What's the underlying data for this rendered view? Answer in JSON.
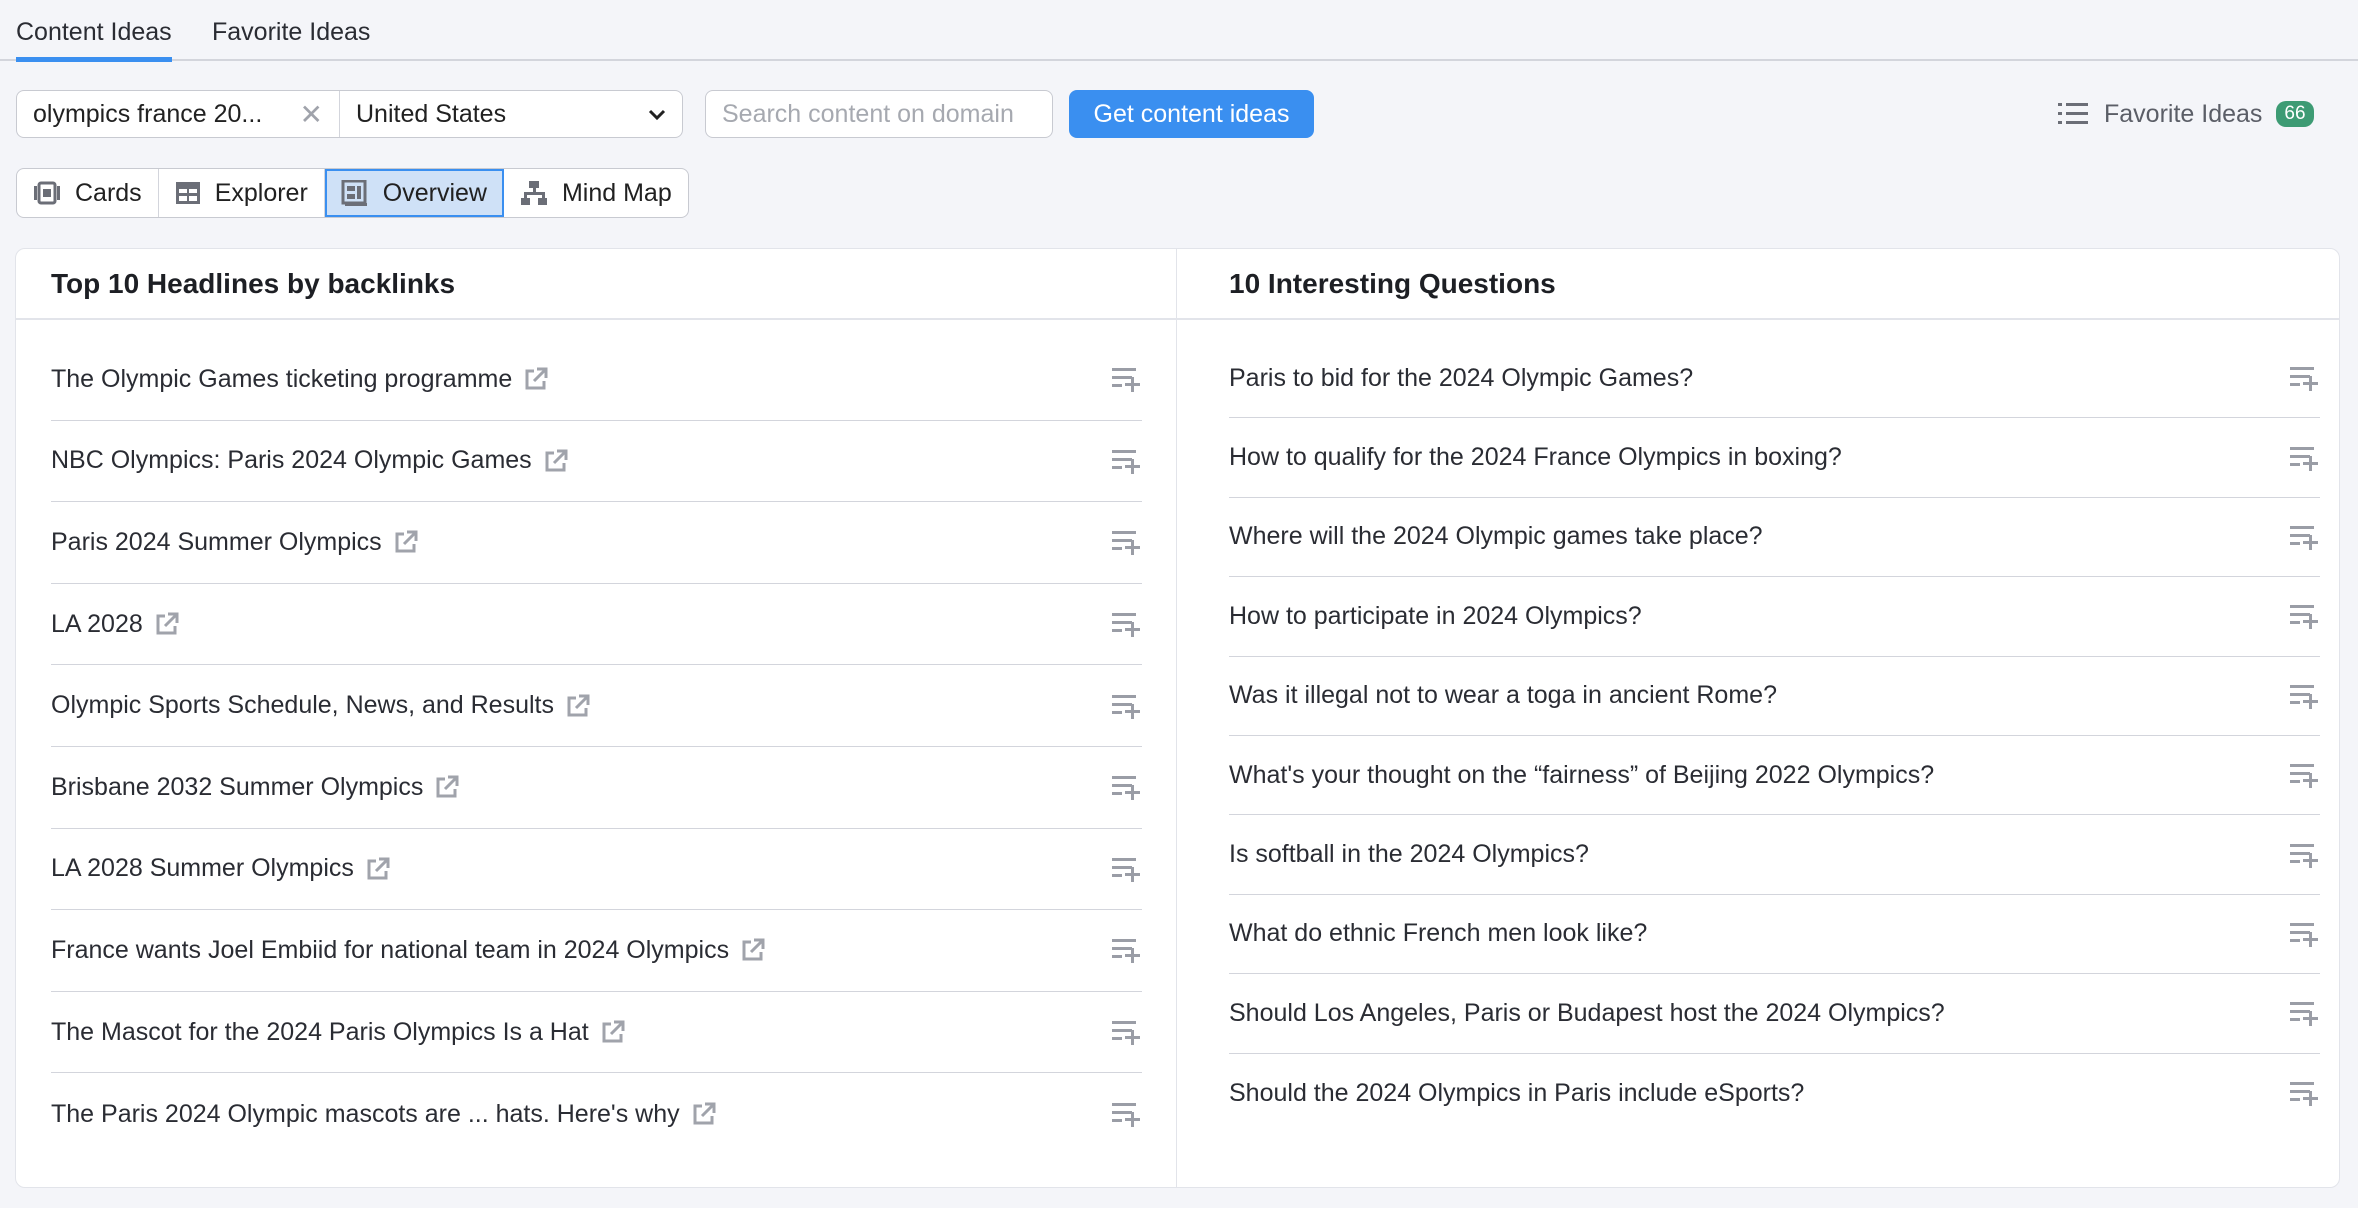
{
  "tabs": [
    {
      "label": "Content Ideas",
      "active": true
    },
    {
      "label": "Favorite Ideas",
      "active": false
    }
  ],
  "toolbar": {
    "keyword_value": "olympics france 20...",
    "country": "United States",
    "search_placeholder": "Search content on domain",
    "submit_label": "Get content ideas",
    "favorites_label": "Favorite Ideas",
    "favorites_count": "66"
  },
  "views": [
    {
      "label": "Cards",
      "icon": "cards-icon"
    },
    {
      "label": "Explorer",
      "icon": "table-icon"
    },
    {
      "label": "Overview",
      "icon": "overview-icon",
      "active": true
    },
    {
      "label": "Mind Map",
      "icon": "mind-map-icon"
    }
  ],
  "headlines": {
    "title": "Top 10 Headlines by backlinks",
    "items": [
      "The Olympic Games ticketing programme",
      "NBC Olympics: Paris 2024 Olympic Games",
      "Paris 2024 Summer Olympics",
      "LA 2028",
      "Olympic Sports Schedule, News, and Results",
      "Brisbane 2032 Summer Olympics",
      "LA 2028 Summer Olympics",
      "France wants Joel Embiid for national team in 2024 Olympics",
      "The Mascot for the 2024 Paris Olympics Is a Hat",
      "The Paris 2024 Olympic mascots are ... hats. Here's why"
    ]
  },
  "questions": {
    "title": "10 Interesting Questions",
    "items": [
      "Paris to bid for the 2024 Olympic Games?",
      "How to qualify for the 2024 France Olympics in boxing?",
      "Where will the 2024 Olympic games take place?",
      "How to participate in 2024 Olympics?",
      "Was it illegal not to wear a toga in ancient Rome?",
      "What's your thought on the “fairness” of Beijing 2022 Olympics?",
      "Is softball in the 2024 Olympics?",
      "What do ethnic French men look like?",
      "Should Los Angeles, Paris or Budapest host the 2024 Olympics?",
      "Should the 2024 Olympics in Paris include eSports?"
    ]
  },
  "colors": {
    "accent": "#3a8ff0",
    "badge": "#3d9b74",
    "active_view_bg": "#cfe1f7"
  }
}
